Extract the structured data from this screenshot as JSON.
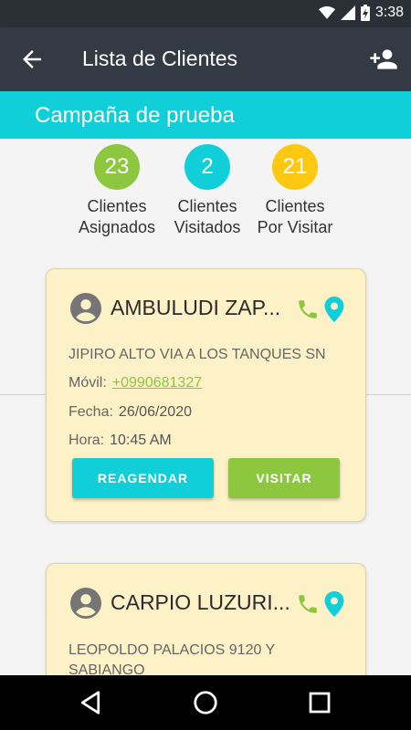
{
  "status_bar": {
    "time": "3:38"
  },
  "app_bar": {
    "title": "Lista de Clientes"
  },
  "campaign": {
    "name": "Campaña de prueba"
  },
  "stats": [
    {
      "value": "23",
      "label_line1": "Clientes",
      "label_line2": "Asignados",
      "color": "#8dc63f"
    },
    {
      "value": "2",
      "label_line1": "Clientes",
      "label_line2": "Visitados",
      "color": "#11cfd9"
    },
    {
      "value": "21",
      "label_line1": "Clientes",
      "label_line2": "Por Visitar",
      "color": "#fcc812"
    }
  ],
  "clients": [
    {
      "name": "AMBULUDI ZAP...",
      "address": "JIPIRO ALTO VIA A LOS TANQUES SN",
      "mobile_label": "Móvil:",
      "mobile": "+0990681327",
      "date_label": "Fecha:",
      "date": "26/06/2020",
      "time_label": "Hora:",
      "time": "10:45 AM",
      "reschedule_label": "REAGENDAR",
      "visit_label": "VISITAR"
    },
    {
      "name": "CARPIO LUZURI...",
      "address": "LEOPOLDO PALACIOS 9120 Y SABIANGO"
    }
  ],
  "colors": {
    "accent_cyan": "#11cfd9",
    "accent_green": "#8dc63f",
    "accent_yellow": "#fcc812",
    "card_bg": "#fdf1c7"
  }
}
